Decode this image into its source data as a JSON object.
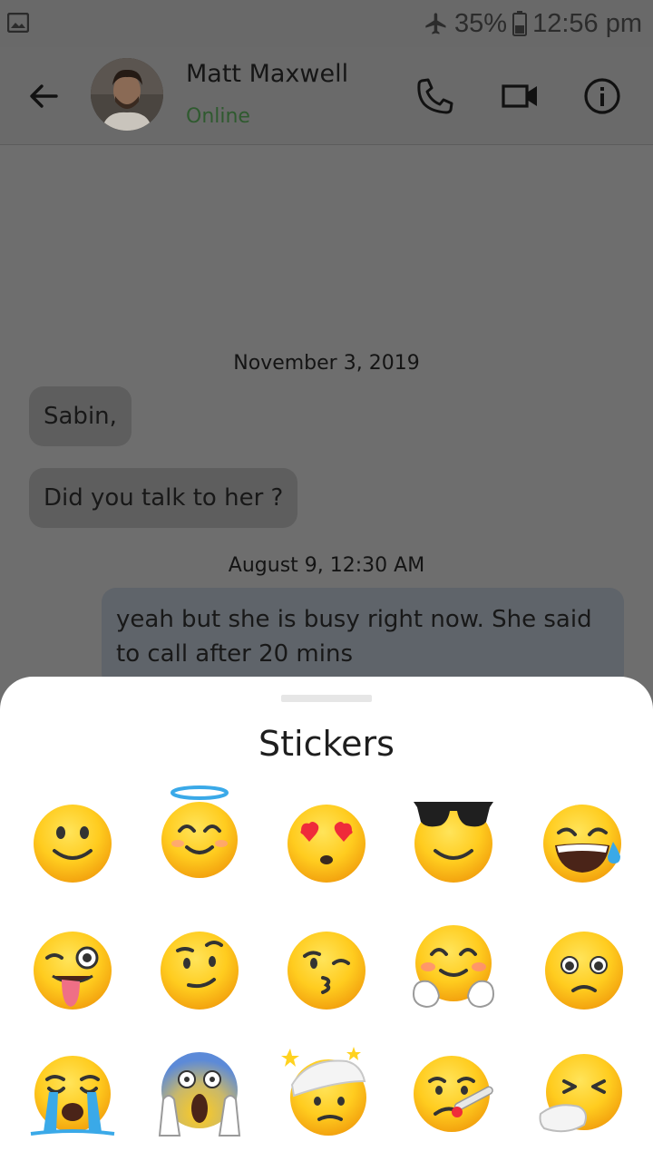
{
  "status_bar": {
    "battery": "35%",
    "time": "12:56 pm",
    "icons": [
      "image-icon",
      "airplane-icon",
      "battery-icon"
    ]
  },
  "header": {
    "name": "Matt Maxwell",
    "status": "Online",
    "status_color": "#2f5a2f",
    "icons": [
      "back-arrow-icon",
      "phone-icon",
      "video-camera-icon",
      "info-icon"
    ]
  },
  "chat": {
    "dates": [
      "November 3, 2019",
      "August 9, 12:30 AM"
    ],
    "messages": [
      {
        "direction": "in",
        "text": "Sabin,"
      },
      {
        "direction": "in",
        "text": "Did you talk to her ?"
      },
      {
        "direction": "out",
        "text": "yeah but she is busy right now. She said to call after 20 mins"
      }
    ]
  },
  "sheet": {
    "title": "Stickers",
    "stickers": [
      "slightly-smiling-face",
      "smiling-face-with-halo",
      "smiling-face-with-heart-eyes",
      "smiling-face-with-sunglasses",
      "grinning-face-with-sweat",
      "winking-face-with-tongue",
      "face-with-raised-eyebrow",
      "face-blowing-kiss",
      "hugging-face",
      "pleading-face",
      "loudly-crying-face",
      "face-screaming-in-fear",
      "face-with-head-bandage",
      "face-with-thermometer",
      "sneezing-face"
    ]
  }
}
